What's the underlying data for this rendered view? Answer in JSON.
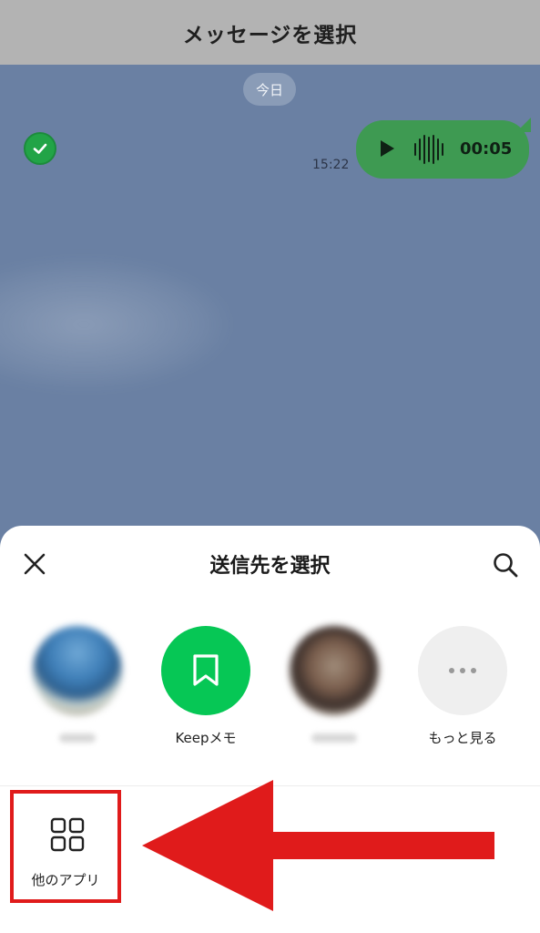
{
  "header": {
    "title": "メッセージを選択"
  },
  "chat": {
    "date_pill": "今日",
    "message": {
      "time": "15:22",
      "duration": "00:05"
    }
  },
  "sheet": {
    "title": "送信先を選択",
    "targets": [
      {
        "label": ""
      },
      {
        "label": "Keepメモ"
      },
      {
        "label": ""
      },
      {
        "label": "もっと見る"
      }
    ],
    "other_apps_label": "他のアプリ"
  },
  "colors": {
    "accent_green": "#06c755",
    "highlight_red": "#e01b1b",
    "chat_background": "#6a80a3"
  },
  "icons": {
    "close": "close-icon",
    "search": "search-icon",
    "keep": "bookmark-icon",
    "more": "more-dots-icon",
    "other_apps": "grid-icon"
  }
}
